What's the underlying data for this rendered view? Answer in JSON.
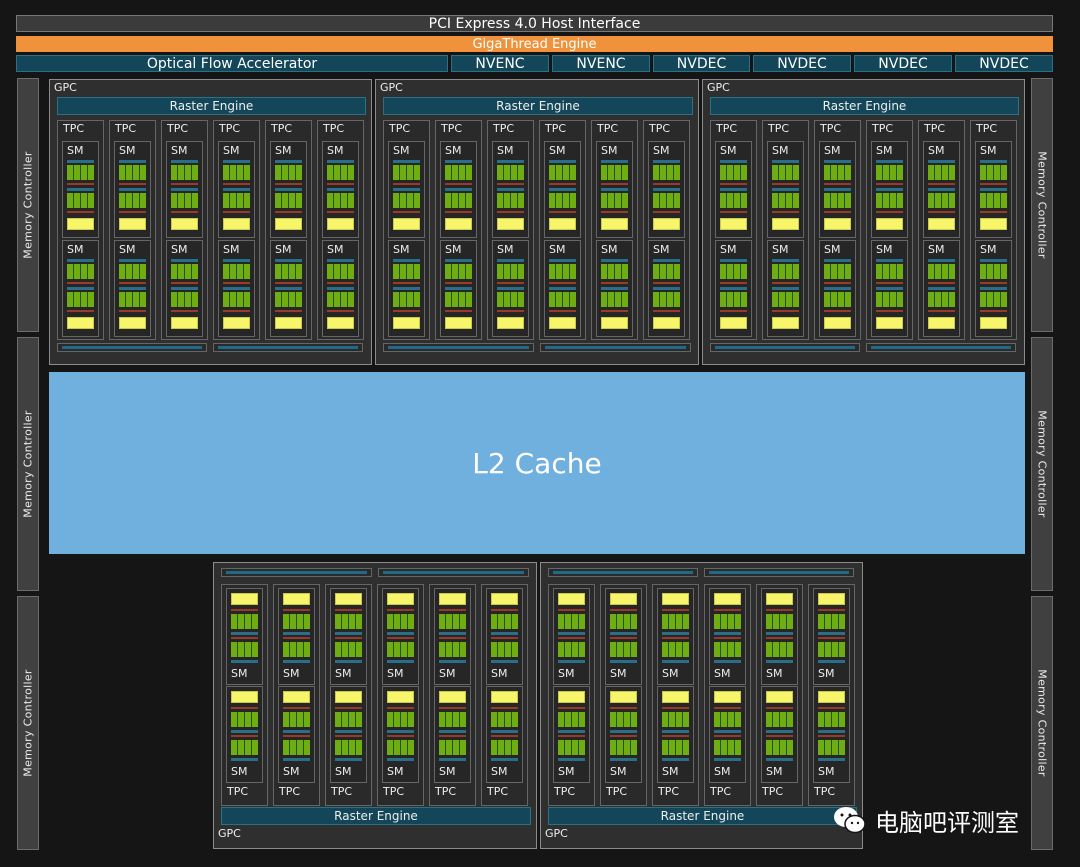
{
  "pcie": "PCI Express 4.0 Host Interface",
  "gigathread": "GigaThread Engine",
  "optical_flow": "Optical Flow Accelerator",
  "video_units": [
    "NVENC",
    "NVENC",
    "NVDEC",
    "NVDEC",
    "NVDEC",
    "NVDEC"
  ],
  "memory_controller": "Memory Controller",
  "l2_cache": "L2 Cache",
  "gpc_label": "GPC",
  "raster_engine": "Raster Engine",
  "tpc_label": "TPC",
  "sm_label": "SM",
  "top_gpc_count": 3,
  "bottom_gpc_count": 2,
  "tpcs_per_gpc": 6,
  "sms_per_tpc": 2,
  "watermark": "电脑吧评测室",
  "colors": {
    "background": "#151515",
    "gigathread": "#f0923c",
    "l2_cache": "#6fb0de",
    "unit_teal": "#134658",
    "cuda_green": "#6fae12",
    "rt_yellow": "#f7f56a"
  }
}
